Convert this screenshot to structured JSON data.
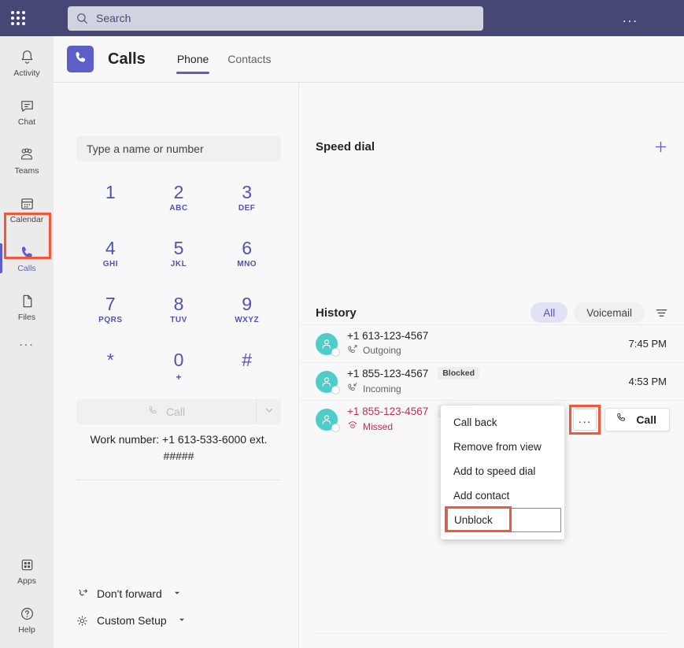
{
  "topbar": {
    "app_launcher": "waffle-icon",
    "search": {
      "icon": "search-icon",
      "placeholder": "Search",
      "value": "Search"
    },
    "more": "..."
  },
  "rail": {
    "items": [
      {
        "label": "Activity",
        "icon": "bell-icon",
        "active": false
      },
      {
        "label": "Chat",
        "icon": "chat-icon",
        "active": false
      },
      {
        "label": "Teams",
        "icon": "teams-icon",
        "active": false
      },
      {
        "label": "Calendar",
        "icon": "calendar-icon",
        "active": false
      },
      {
        "label": "Calls",
        "icon": "phone-icon",
        "active": true
      },
      {
        "label": "Files",
        "icon": "file-icon",
        "active": false
      }
    ],
    "more": "...",
    "bottom": [
      {
        "label": "Apps",
        "icon": "apps-icon"
      },
      {
        "label": "Help",
        "icon": "help-icon"
      }
    ]
  },
  "header": {
    "badge_icon": "phone-icon",
    "title": "Calls",
    "tabs": [
      {
        "label": "Phone",
        "selected": true
      },
      {
        "label": "Contacts",
        "selected": false
      }
    ]
  },
  "dialpad": {
    "input_placeholder": "Type a name or number",
    "input_value": "",
    "keys": [
      {
        "digit": "1",
        "sub": ""
      },
      {
        "digit": "2",
        "sub": "ABC"
      },
      {
        "digit": "3",
        "sub": "DEF"
      },
      {
        "digit": "4",
        "sub": "GHI"
      },
      {
        "digit": "5",
        "sub": "JKL"
      },
      {
        "digit": "6",
        "sub": "MNO"
      },
      {
        "digit": "7",
        "sub": "PQRS"
      },
      {
        "digit": "8",
        "sub": "TUV"
      },
      {
        "digit": "9",
        "sub": "WXYZ"
      },
      {
        "digit": "*",
        "sub": ""
      },
      {
        "digit": "0",
        "sub": "+"
      },
      {
        "digit": "#",
        "sub": ""
      }
    ],
    "call_button": {
      "label": "Call",
      "icon": "phone-icon",
      "disabled": true
    },
    "call_dropdown_icon": "chevron-down-icon",
    "work_number": "Work number: +1 613-533-6000 ext. #####"
  },
  "forwarding": [
    {
      "label": "Don't forward",
      "icon": "call-forward-icon",
      "caret": "caret-down-icon"
    },
    {
      "label": "Custom Setup",
      "icon": "gear-icon",
      "caret": "caret-down-icon"
    }
  ],
  "speed_dial": {
    "title": "Speed dial",
    "add_icon": "plus-icon"
  },
  "history": {
    "title": "History",
    "filters": [
      {
        "label": "All",
        "selected": true
      },
      {
        "label": "Voicemail",
        "selected": false
      }
    ],
    "filter_icon": "filter-icon",
    "rows": [
      {
        "number": "+1 613-123-4567",
        "badge": "",
        "direction": "Outgoing",
        "direction_icon": "call-outgoing-icon",
        "time": "7:45 PM",
        "missed": false
      },
      {
        "number": "+1 855-123-4567",
        "badge": "Blocked",
        "direction": "Incoming",
        "direction_icon": "call-incoming-icon",
        "time": "4:53 PM",
        "missed": false
      },
      {
        "number": "+1 855-123-4567",
        "badge": "Blocked",
        "direction": "Missed",
        "direction_icon": "call-missed-icon",
        "time": "",
        "missed": true
      }
    ],
    "row_actions": {
      "more_label": "...",
      "call_label": "Call",
      "call_icon": "phone-icon"
    }
  },
  "context_menu": {
    "items": [
      {
        "label": "Call back",
        "highlighted": false
      },
      {
        "label": "Remove from view",
        "highlighted": false
      },
      {
        "label": "Add to speed dial",
        "highlighted": false
      },
      {
        "label": "Add contact",
        "highlighted": false
      },
      {
        "label": "Unblock",
        "highlighted": true
      }
    ]
  },
  "colors": {
    "brand_purple": "#464775",
    "accent_purple": "#5b5fc7",
    "highlight_red": "#f4553b",
    "missed_red": "#c4314b",
    "avatar_teal": "#4ecdc8"
  }
}
